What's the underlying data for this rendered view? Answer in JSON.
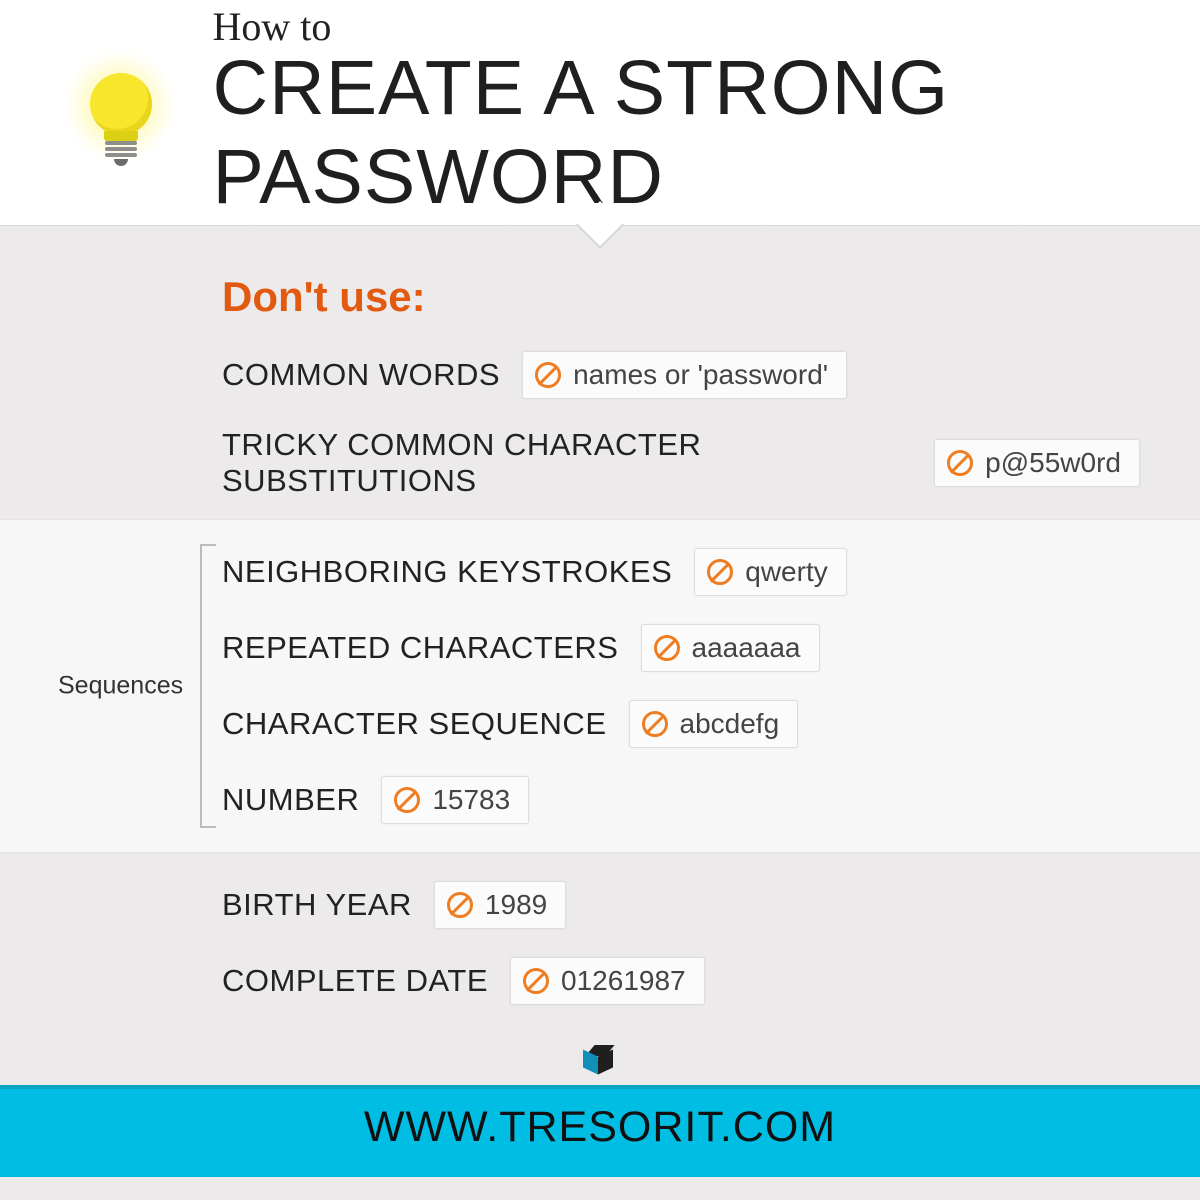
{
  "header": {
    "pretitle": "How to",
    "title": "CREATE A STRONG PASSWORD"
  },
  "dont_heading": "Don't use:",
  "group_a": [
    {
      "label": "COMMON WORDS",
      "example": "names or 'password'"
    },
    {
      "label": "TRICKY COMMON CHARACTER SUBSTITUTIONS",
      "example": "p@55w0rd"
    }
  ],
  "sequences_label": "Sequences",
  "group_b": [
    {
      "label": "NEIGHBORING KEYSTROKES",
      "example": "qwerty"
    },
    {
      "label": "REPEATED CHARACTERS",
      "example": "aaaaaaa"
    },
    {
      "label": "CHARACTER SEQUENCE",
      "example": "abcdefg"
    },
    {
      "label": "NUMBER",
      "example": "15783"
    }
  ],
  "group_c": [
    {
      "label": "BIRTH YEAR",
      "example": "1989"
    },
    {
      "label": "COMPLETE DATE",
      "example": "01261987"
    }
  ],
  "footer_url": "WWW.TRESORIT.COM"
}
